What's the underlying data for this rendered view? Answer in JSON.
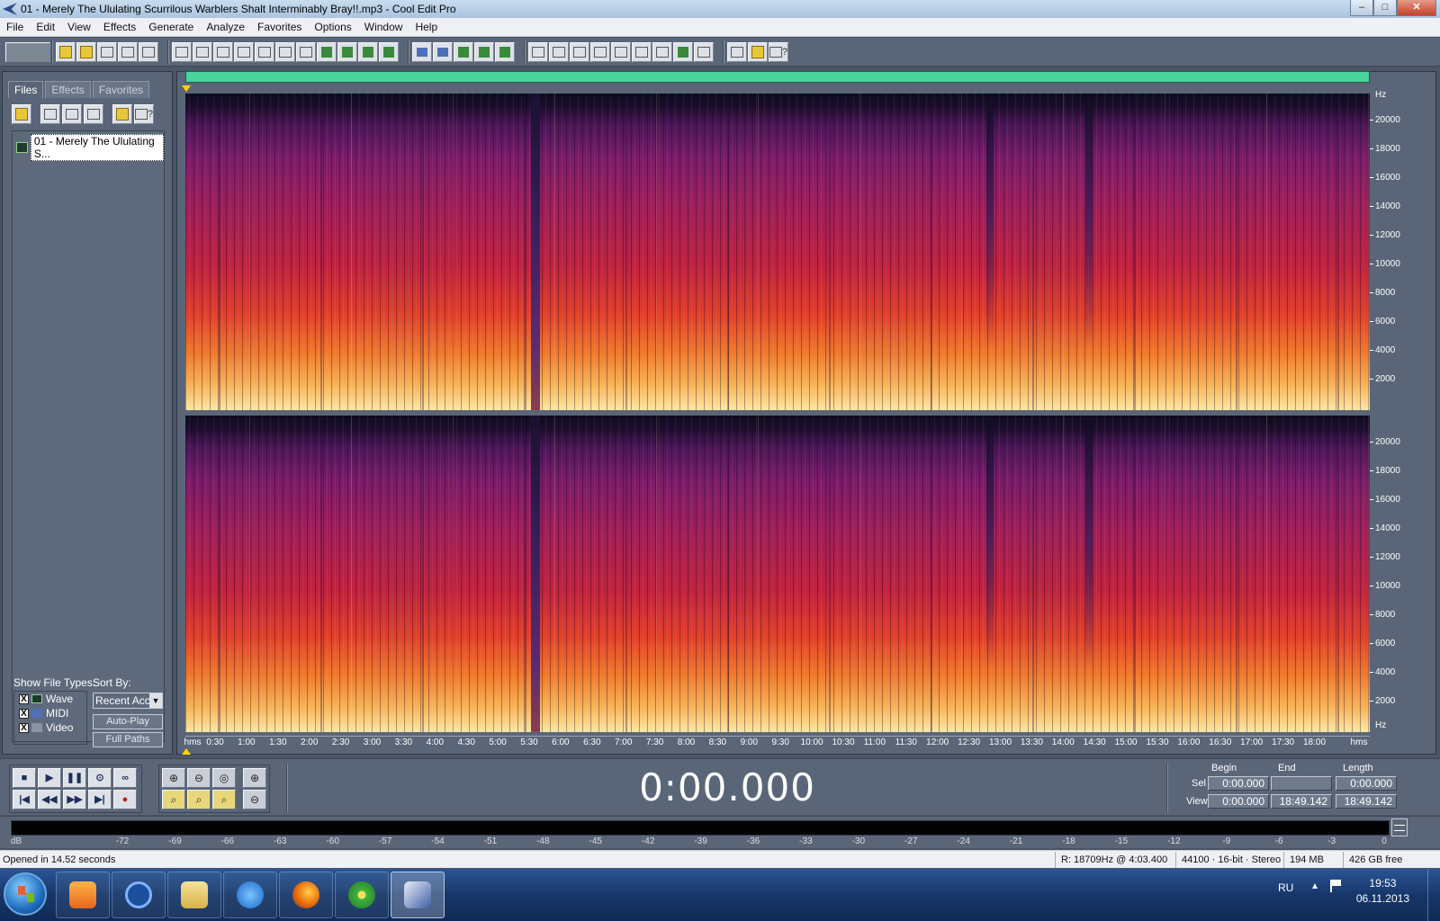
{
  "window": {
    "title": "01 - Merely The Ululating Scurrilous Warblers Shalt Interminably Bray!!.mp3 - Cool Edit Pro",
    "min_symbol": "–",
    "max_symbol": "□",
    "close_symbol": "✕"
  },
  "menu": [
    "File",
    "Edit",
    "View",
    "Effects",
    "Generate",
    "Analyze",
    "Favorites",
    "Options",
    "Window",
    "Help"
  ],
  "organizer": {
    "tabs": [
      "Files",
      "Effects",
      "Favorites"
    ],
    "active_tab": "Files",
    "files": [
      "01 - Merely The Ululating S..."
    ],
    "show_file_types_label": "Show File Types:",
    "sort_by_label": "Sort By:",
    "types": [
      {
        "label": "Wave",
        "checked": true
      },
      {
        "label": "MIDI",
        "checked": true
      },
      {
        "label": "Video",
        "checked": true
      }
    ],
    "check_mark": "X",
    "sort_value": "Recent Acc",
    "autoplay_label": "Auto-Play",
    "fullpaths_label": "Full Paths"
  },
  "hz_axis": {
    "unit": "Hz",
    "ticks_top": [
      "20000",
      "18000",
      "16000",
      "14000",
      "12000",
      "10000",
      "8000",
      "6000",
      "4000",
      "2000"
    ],
    "ticks_bottom": [
      "20000",
      "18000",
      "16000",
      "14000",
      "12000",
      "10000",
      "8000",
      "6000",
      "4000",
      "2000",
      "Hz"
    ]
  },
  "timeline": {
    "unit_left": "hms",
    "unit_right": "hms",
    "labels": [
      "0:30",
      "1:00",
      "1:30",
      "2:00",
      "2:30",
      "3:00",
      "3:30",
      "4:00",
      "4:30",
      "5:00",
      "5:30",
      "6:00",
      "6:30",
      "7:00",
      "7:30",
      "8:00",
      "8:30",
      "9:00",
      "9:30",
      "10:00",
      "10:30",
      "11:00",
      "11:30",
      "12:00",
      "12:30",
      "13:00",
      "13:30",
      "14:00",
      "14:30",
      "15:00",
      "15:30",
      "16:00",
      "16:30",
      "17:00",
      "17:30",
      "18:00"
    ]
  },
  "transport": {
    "time": "0:00.000",
    "selection": {
      "headers": [
        "Begin",
        "End",
        "Length"
      ],
      "sel_label": "Sel",
      "view_label": "View",
      "sel": [
        "0:00.000",
        "",
        "0:00.000"
      ],
      "view": [
        "0:00.000",
        "18:49.142",
        "18:49.142"
      ]
    }
  },
  "meter": {
    "db_labels": [
      "dB",
      "-72",
      "-69",
      "-66",
      "-63",
      "-60",
      "-57",
      "-54",
      "-51",
      "-48",
      "-45",
      "-42",
      "-39",
      "-36",
      "-33",
      "-30",
      "-27",
      "-24",
      "-21",
      "-18",
      "-15",
      "-12",
      "-9",
      "-6",
      "-3",
      "0"
    ]
  },
  "status": {
    "left": "Opened in 14.52 seconds",
    "cursor": "R: 18709Hz @  4:03.400",
    "format": "44100 · 16-bit · Stereo",
    "size": "194 MB",
    "free": "426 GB free"
  },
  "taskbar": {
    "lang": "RU",
    "tray_arrow": "▲",
    "time": "19:53",
    "date": "06.11.2013"
  }
}
